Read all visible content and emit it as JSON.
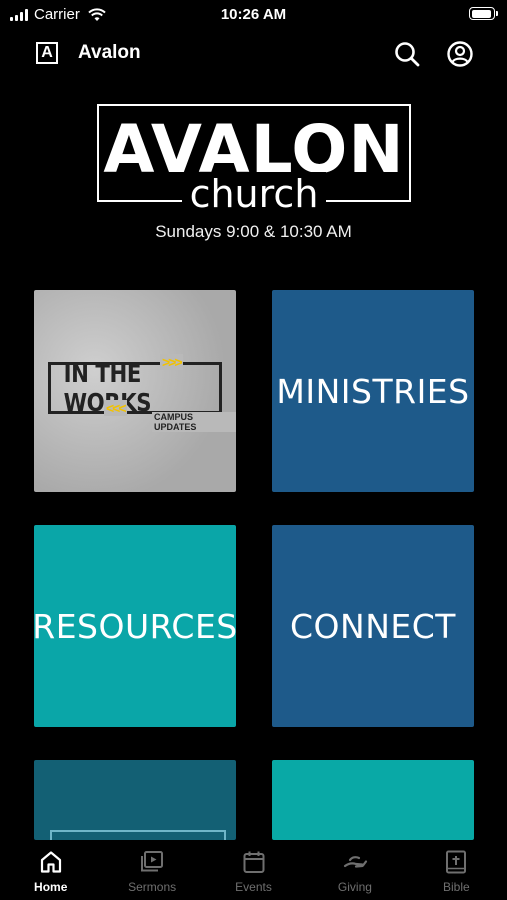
{
  "status_bar": {
    "carrier": "Carrier",
    "time": "10:26 AM",
    "battery_level": 0.95
  },
  "header": {
    "logo_letter": "A",
    "title": "Avalon"
  },
  "church": {
    "name": "AVALON",
    "subtitle": "church",
    "schedule": "Sundays 9:00 & 10:30 AM"
  },
  "tiles": [
    {
      "title": "IN THE WORKS",
      "arrows_top": ">>>",
      "arrows_bottom": "<<<",
      "subtitle": "CAMPUS UPDATES"
    },
    {
      "label": "MINISTRIES",
      "color": "#1e5a8a"
    },
    {
      "label": "RESOURCES",
      "color": "#0aa6a8"
    },
    {
      "label": "CONNECT",
      "color": "#1e5a8a"
    },
    {
      "label": "",
      "color": "#136074"
    },
    {
      "label": "",
      "color": "#09a9a6"
    }
  ],
  "tabs": [
    {
      "label": "Home",
      "icon": "home-icon",
      "active": true
    },
    {
      "label": "Sermons",
      "icon": "video-playlist-icon",
      "active": false
    },
    {
      "label": "Events",
      "icon": "calendar-icon",
      "active": false
    },
    {
      "label": "Giving",
      "icon": "giving-hand-icon",
      "active": false
    },
    {
      "label": "Bible",
      "icon": "bible-icon",
      "active": false
    }
  ],
  "colors": {
    "background": "#000000",
    "tab_inactive": "#6f6f6f"
  }
}
